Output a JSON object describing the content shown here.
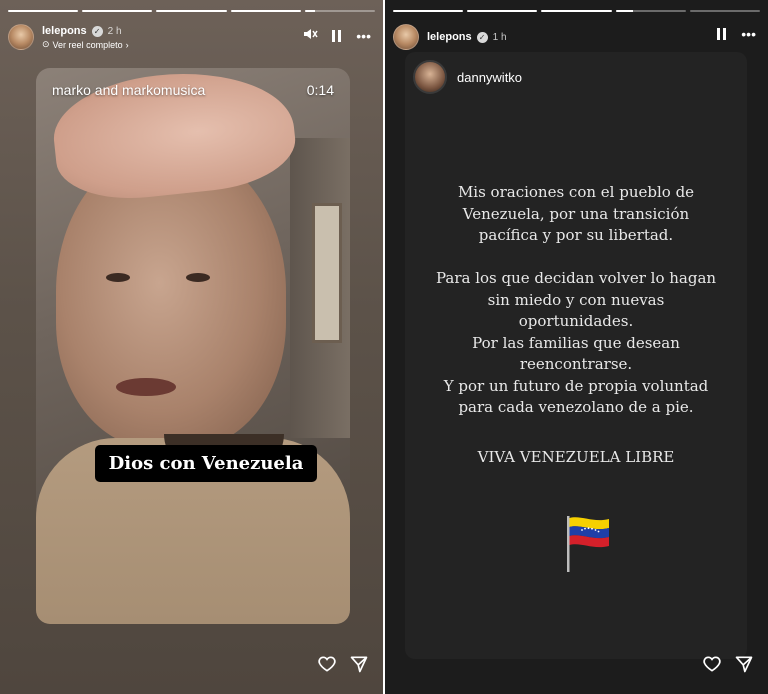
{
  "left_story": {
    "progress": [
      1,
      1,
      1,
      1,
      0.15
    ],
    "username": "lelepons",
    "verified_mark": "✓",
    "time": "2 h",
    "reel_link": "Ver reel completo",
    "video": {
      "credit": "marko and markomusica",
      "timer": "0:14",
      "caption": "Dios con Venezuela"
    }
  },
  "right_story": {
    "progress": [
      1,
      1,
      1,
      0.25,
      0
    ],
    "username": "lelepons",
    "verified_mark": "✓",
    "time": "1 h",
    "card": {
      "username": "dannywitko",
      "lines": [
        "Mis oraciones con el pueblo de",
        "Venezuela, por una transición",
        "pacífica y por su libertad.",
        "Para los que decidan volver lo hagan",
        "sin miedo y con nuevas",
        "oportunidades.",
        "Por las familias que desean",
        "reencontrarse.",
        "Y por un futuro de propia voluntad",
        "para cada venezolano de a pie.",
        "VIVA VENEZUELA LIBRE"
      ]
    },
    "flag_colors": [
      "#f6d000",
      "#1f3fa8",
      "#d4202a"
    ]
  },
  "icons": {
    "mute": "mute-icon",
    "pause": "pause-icon",
    "more": "more-icon",
    "like": "heart-icon",
    "share": "send-icon"
  }
}
